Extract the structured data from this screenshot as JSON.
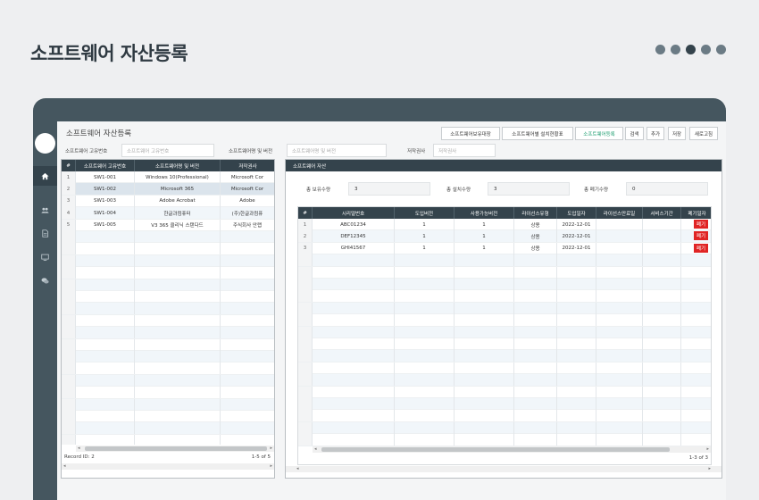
{
  "page_title": "소프트웨어 자산등록",
  "pagination_dots": 5,
  "app": {
    "screen_title": "소프트웨어 자산등록",
    "buttons": {
      "inventory_ledger": "소프트웨어보유대장",
      "install_status": "소프트웨어별 설치현황표",
      "register": "소프트웨어등록",
      "search": "검색",
      "add": "추가",
      "save": "저장",
      "refresh": "새로고침"
    },
    "search": {
      "id_label": "소프트웨어 고유번호",
      "id_placeholder": "소프트웨어 고유번호",
      "name_label": "소프트웨어명 및 버전",
      "name_placeholder": "소프트웨어명 및 버전",
      "vendor_label": "저작권사",
      "vendor_placeholder": "저작권사"
    }
  },
  "left_grid": {
    "headers": [
      "#",
      "소프트웨어 고유번호",
      "소프트웨어명 및 버전",
      "저작권사"
    ],
    "rows": [
      {
        "n": "1",
        "id": "SW1-001",
        "name": "Windows 10(Professional)",
        "vendor": "Microsoft Cor"
      },
      {
        "n": "2",
        "id": "SW1-002",
        "name": "Microsoft 365",
        "vendor": "Microsoft Cor"
      },
      {
        "n": "3",
        "id": "SW1-003",
        "name": "Adobe Acrobat",
        "vendor": "Adobe"
      },
      {
        "n": "4",
        "id": "SW1-004",
        "name": "한글과컴퓨터",
        "vendor": "(주)한글과컴퓨"
      },
      {
        "n": "5",
        "id": "SW1-005",
        "name": "V3 365 클리닉 스탠다드",
        "vendor": "주식회사 안랩"
      }
    ],
    "selected_row": 2,
    "record_id_text": "Record ID: 2",
    "range_text": "1-5 of 5"
  },
  "right_panel": {
    "title": "소프트웨어 자산",
    "summary": {
      "owned_label": "총 보유수량",
      "owned_value": "3",
      "installed_label": "총 설치수량",
      "installed_value": "3",
      "disposed_label": "총 폐기수량",
      "disposed_value": "0"
    },
    "grid": {
      "headers": [
        "#",
        "시리얼번호",
        "도입버전",
        "사용가능버전",
        "라이선스유형",
        "도입일자",
        "라이선스만료일",
        "서비스기간",
        "폐기일자"
      ],
      "rows": [
        {
          "n": "1",
          "serial": "ABC01234",
          "intro_ver": "1",
          "usable_ver": "1",
          "license_type": "상용",
          "intro_date": "2022-12-01",
          "expire": "",
          "service": "",
          "dispose": "폐기"
        },
        {
          "n": "2",
          "serial": "DEF12345",
          "intro_ver": "1",
          "usable_ver": "1",
          "license_type": "상용",
          "intro_date": "2022-12-01",
          "expire": "",
          "service": "",
          "dispose": "폐기"
        },
        {
          "n": "3",
          "serial": "GHI41567",
          "intro_ver": "1",
          "usable_ver": "1",
          "license_type": "상용",
          "intro_date": "2022-12-01",
          "expire": "",
          "service": "",
          "dispose": "폐기"
        }
      ],
      "range_text": "1-3 of 3"
    }
  },
  "sidebar_icons": [
    "home-icon",
    "users-icon",
    "document-icon",
    "monitor-icon",
    "chat-icon"
  ],
  "colors": {
    "dark": "#34434c",
    "frame": "#45565f",
    "accent": "#1a9c6e",
    "danger": "#e02424"
  }
}
